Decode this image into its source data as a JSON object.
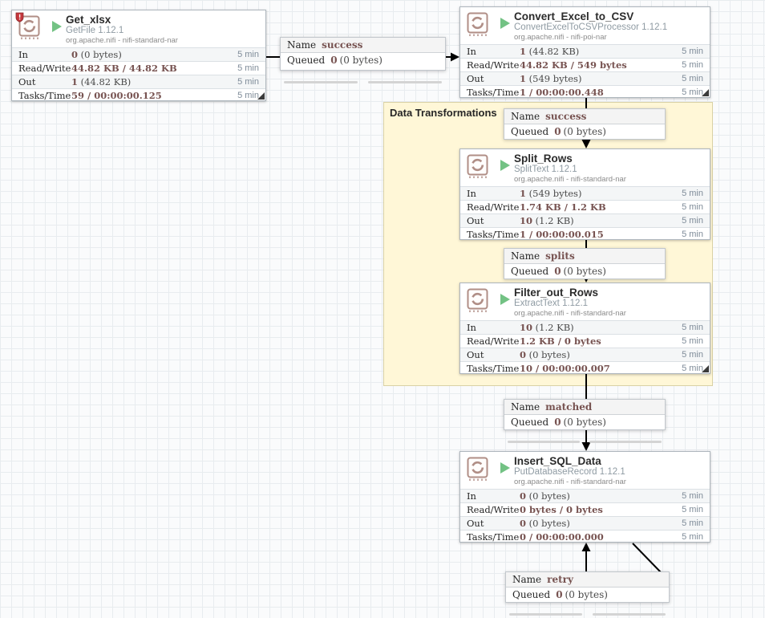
{
  "colors": {
    "stat_value_accent": "#775351",
    "run_green": "#73c284",
    "group_label_yellow": "#fff7d7",
    "restricted_red": "#c5373c",
    "icon_rose": "#b08e86"
  },
  "group_label": {
    "text": "Data Transformations"
  },
  "processors": [
    {
      "name": "Get_xlsx",
      "type": "GetFile 1.12.1",
      "bundle": "org.apache.nifi - nifi-standard-nar",
      "restricted": true,
      "stats": [
        {
          "label": "In",
          "strong": "0",
          "rest": " (0 bytes)",
          "window": "5 min"
        },
        {
          "label": "Read/Write",
          "strong": "44.82 KB / 44.82 KB",
          "rest": "",
          "window": "5 min"
        },
        {
          "label": "Out",
          "strong": "1",
          "rest": " (44.82 KB)",
          "window": "5 min"
        },
        {
          "label": "Tasks/Time",
          "strong": "59 / 00:00:00.125",
          "rest": "",
          "window": "5 min"
        }
      ]
    },
    {
      "name": "Convert_Excel_to_CSV",
      "type": "ConvertExcelToCSVProcessor 1.12.1",
      "bundle": "org.apache.nifi - nifi-poi-nar",
      "restricted": false,
      "stats": [
        {
          "label": "In",
          "strong": "1",
          "rest": " (44.82 KB)",
          "window": "5 min"
        },
        {
          "label": "Read/Write",
          "strong": "44.82 KB / 549 bytes",
          "rest": "",
          "window": "5 min"
        },
        {
          "label": "Out",
          "strong": "1",
          "rest": " (549 bytes)",
          "window": "5 min"
        },
        {
          "label": "Tasks/Time",
          "strong": "1 / 00:00:00.448",
          "rest": "",
          "window": "5 min"
        }
      ]
    },
    {
      "name": "Split_Rows",
      "type": "SplitText 1.12.1",
      "bundle": "org.apache.nifi - nifi-standard-nar",
      "restricted": false,
      "stats": [
        {
          "label": "In",
          "strong": "1",
          "rest": " (549 bytes)",
          "window": "5 min"
        },
        {
          "label": "Read/Write",
          "strong": "1.74 KB / 1.2 KB",
          "rest": "",
          "window": "5 min"
        },
        {
          "label": "Out",
          "strong": "10",
          "rest": " (1.2 KB)",
          "window": "5 min"
        },
        {
          "label": "Tasks/Time",
          "strong": "1 / 00:00:00.015",
          "rest": "",
          "window": "5 min"
        }
      ]
    },
    {
      "name": "Filter_out_Rows",
      "type": "ExtractText 1.12.1",
      "bundle": "org.apache.nifi - nifi-standard-nar",
      "restricted": false,
      "stats": [
        {
          "label": "In",
          "strong": "10",
          "rest": " (1.2 KB)",
          "window": "5 min"
        },
        {
          "label": "Read/Write",
          "strong": "1.2 KB / 0 bytes",
          "rest": "",
          "window": "5 min"
        },
        {
          "label": "Out",
          "strong": "0",
          "rest": " (0 bytes)",
          "window": "5 min"
        },
        {
          "label": "Tasks/Time",
          "strong": "10 / 00:00:00.007",
          "rest": "",
          "window": "5 min"
        }
      ]
    },
    {
      "name": "Insert_SQL_Data",
      "type": "PutDatabaseRecord 1.12.1",
      "bundle": "org.apache.nifi - nifi-standard-nar",
      "restricted": false,
      "stats": [
        {
          "label": "In",
          "strong": "0",
          "rest": " (0 bytes)",
          "window": "5 min"
        },
        {
          "label": "Read/Write",
          "strong": "0 bytes / 0 bytes",
          "rest": "",
          "window": "5 min"
        },
        {
          "label": "Out",
          "strong": "0",
          "rest": " (0 bytes)",
          "window": "5 min"
        },
        {
          "label": "Tasks/Time",
          "strong": "0 / 00:00:00.000",
          "rest": "",
          "window": "5 min"
        }
      ]
    }
  ],
  "connections": [
    {
      "name_key": "Name",
      "name": "success",
      "queued_key": "Queued",
      "queued_strong": "0",
      "queued_rest": "(0 bytes)"
    },
    {
      "name_key": "Name",
      "name": "success",
      "queued_key": "Queued",
      "queued_strong": "0",
      "queued_rest": "(0 bytes)"
    },
    {
      "name_key": "Name",
      "name": "splits",
      "queued_key": "Queued",
      "queued_strong": "0",
      "queued_rest": "(0 bytes)"
    },
    {
      "name_key": "Name",
      "name": "matched",
      "queued_key": "Queued",
      "queued_strong": "0",
      "queued_rest": "(0 bytes)"
    },
    {
      "name_key": "Name",
      "name": "retry",
      "queued_key": "Queued",
      "queued_strong": "0",
      "queued_rest": "(0 bytes)"
    }
  ]
}
